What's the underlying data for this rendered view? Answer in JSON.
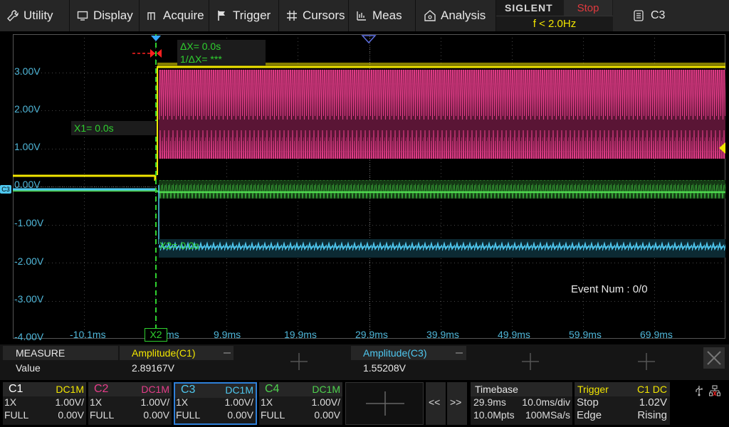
{
  "menu": [
    {
      "label": "Utility",
      "icon": "wrench-icon"
    },
    {
      "label": "Display",
      "icon": "monitor-icon"
    },
    {
      "label": "Acquire",
      "icon": "acquire-icon"
    },
    {
      "label": "Trigger",
      "icon": "flag-icon"
    },
    {
      "label": "Cursors",
      "icon": "cursor-grid-icon"
    },
    {
      "label": "Meas",
      "icon": "ruler-icon"
    },
    {
      "label": "Analysis",
      "icon": "analysis-icon"
    }
  ],
  "brand": {
    "logo": "SIGLENT",
    "run_state": "Stop",
    "frequency": "f < 2.0Hz"
  },
  "channel_select": {
    "label": "C3",
    "icon": "channel-config-icon"
  },
  "screen": {
    "y_labels": [
      "3.00V",
      "2.00V",
      "1.00V",
      "0.00V",
      "-1.00V",
      "-2.00V",
      "-3.00V",
      "-4.00V"
    ],
    "x_labels": [
      "-10.1ms",
      "ms",
      "9.9ms",
      "19.9ms",
      "29.9ms",
      "39.9ms",
      "49.9ms",
      "59.9ms",
      "69.9ms"
    ],
    "cursor_info": {
      "dx": "ΔX= 0.0s",
      "inv_dx": "1/ΔX= ***"
    },
    "x1_label": "X1= 0.0s",
    "x2_label": "X2= 0.0s",
    "x2_marker": "X2",
    "c3_marker": "C3",
    "event_num": "Event Num : 0/0"
  },
  "measure": {
    "title": "MEASURE",
    "row_label": "Value",
    "items": [
      {
        "name": "Amplitude(C1)",
        "value": "2.89167V"
      },
      {
        "name": "Amplitude(C3)",
        "value": "1.55208V"
      }
    ]
  },
  "channels": [
    {
      "name": "C1",
      "coupling": "DC1M",
      "probe": "1X",
      "scale": "1.00V/",
      "bw": "FULL",
      "offset": "0.00V",
      "color": "#f2e600"
    },
    {
      "name": "C2",
      "coupling": "DC1M",
      "probe": "1X",
      "scale": "1.00V/",
      "bw": "FULL",
      "offset": "0.00V",
      "color": "#e63d8a"
    },
    {
      "name": "C3",
      "coupling": "DC1M",
      "probe": "1X",
      "scale": "1.00V/",
      "bw": "FULL",
      "offset": "0.00V",
      "color": "#4fc8f0"
    },
    {
      "name": "C4",
      "coupling": "DC1M",
      "probe": "1X",
      "scale": "1.00V/",
      "bw": "FULL",
      "offset": "0.00V",
      "color": "#4ed24e"
    }
  ],
  "nav": {
    "prev": "<<",
    "next": ">>"
  },
  "timebase": {
    "title": "Timebase",
    "delay": "29.9ms",
    "scale": "10.0ms/div",
    "memory": "10.0Mpts",
    "sample_rate": "100MSa/s"
  },
  "trigger": {
    "title": "Trigger",
    "source": "C1 DC",
    "state": "Stop",
    "level": "1.02V",
    "type": "Edge",
    "slope": "Rising"
  },
  "colors": {
    "c1": "#f2e600",
    "c2": "#e63d8a",
    "c3": "#4fc8f0",
    "c4": "#4ed24e",
    "cursor": "#2fd12f",
    "trigger": "#f2e600"
  }
}
